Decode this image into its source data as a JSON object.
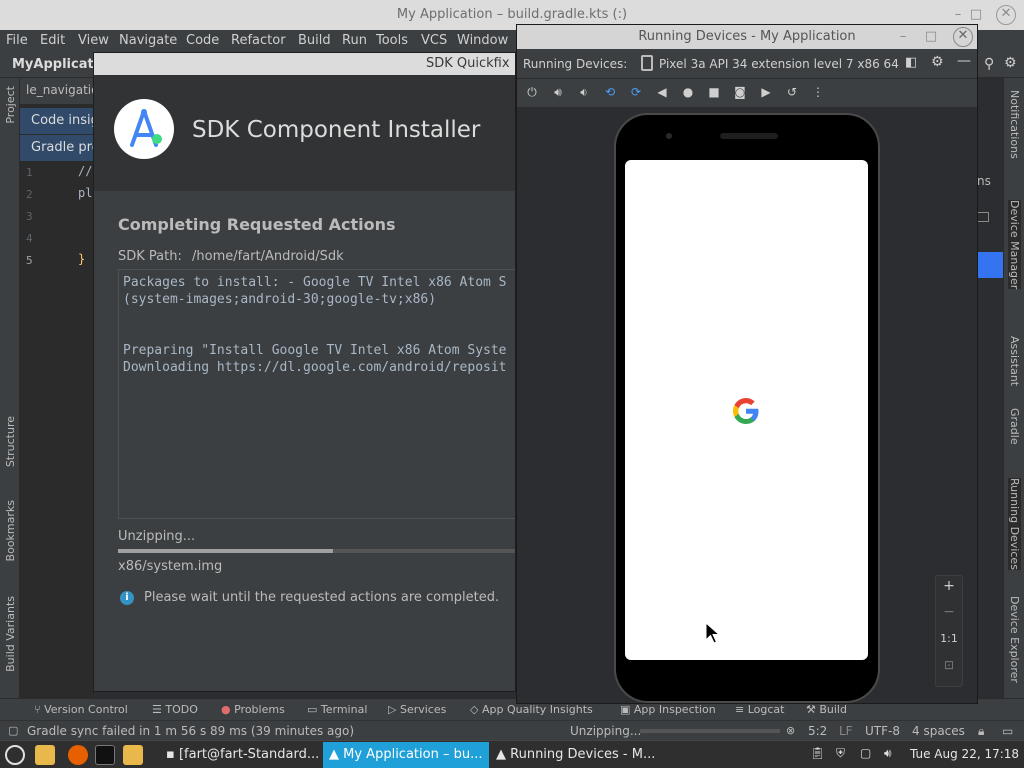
{
  "ide": {
    "window_title": "My Application – build.gradle.kts (:)",
    "menu": [
      "File",
      "Edit",
      "View",
      "Navigate",
      "Code",
      "Refactor",
      "Build",
      "Run",
      "Tools",
      "VCS",
      "Window"
    ],
    "project_name": "MyApplicatio",
    "editor_tab": "le_navigatio",
    "banners": [
      "Code insig",
      "Gradle pro"
    ],
    "line_numbers": [
      "1",
      "2",
      "3",
      "4",
      "5"
    ],
    "code_lines": [
      "//",
      "pl",
      "",
      "",
      "}"
    ],
    "left_tool_tabs": [
      "Project",
      "Structure",
      "Bookmarks",
      "Build Variants"
    ],
    "right_tool_tabs": [
      "Notifications",
      "Device Manager",
      "Assistant",
      "Gradle",
      "Running Devices",
      "Device Explorer"
    ],
    "right_editor_fragment": "ns",
    "bottom_tools": [
      "Version Control",
      "TODO",
      "Problems",
      "Terminal",
      "Services",
      "App Quality Insights",
      "App Inspection",
      "Logcat",
      "Build"
    ],
    "status": {
      "message": "Gradle sync failed in 1 m 56 s 89 ms (39 minutes ago)",
      "progress_label": "Unzipping...",
      "position": "5:2",
      "line_sep": "LF",
      "encoding": "UTF-8",
      "indent": "4 spaces"
    }
  },
  "sdk_dialog": {
    "window_title": "SDK Quickfix I",
    "header_title": "SDK Component Installer",
    "section_title": "Completing Requested Actions",
    "sdk_path_label": "SDK Path:",
    "sdk_path_value": "/home/fart/Android/Sdk",
    "log_lines": [
      "Packages to install: - Google TV Intel x86 Atom S",
      "(system-images;android-30;google-tv;x86)",
      "",
      "",
      "Preparing \"Install Google TV Intel x86 Atom Syste",
      "Downloading https://dl.google.com/android/reposit"
    ],
    "status_text": "Unzipping...",
    "progress_fraction": 0.54,
    "current_file": "x86/system.img",
    "info_message": "Please wait until the requested actions are completed."
  },
  "running_devices": {
    "window_title": "Running Devices - My Application",
    "tab_label": "Running Devices:",
    "device_name": "Pixel 3a API 34 extension level 7 x86 64",
    "zoom_ratio_label": "1:1"
  },
  "taskbar": {
    "tasks": [
      "[fart@fart-Standard...",
      "My Application – bu...",
      "Running Devices - M..."
    ],
    "active_task_index": 1,
    "clock": "Tue Aug 22, 17:18"
  },
  "colors": {
    "accent_active_task": "#1fa0d8",
    "ide_background": "#2b2d30",
    "banner": "#314a6a",
    "info_icon": "#3592c4"
  },
  "icons": [
    "android-studio-logo-icon",
    "google-g-icon",
    "info-icon",
    "mouse-cursor-icon",
    "power-icon",
    "volume-up-icon",
    "volume-down-icon",
    "rotate-left-icon",
    "rotate-right-icon",
    "back-icon",
    "home-icon",
    "overview-icon",
    "camera-icon",
    "record-icon",
    "reset-icon",
    "more-icon",
    "zoom-in-icon",
    "zoom-out-icon",
    "settings-icon"
  ]
}
